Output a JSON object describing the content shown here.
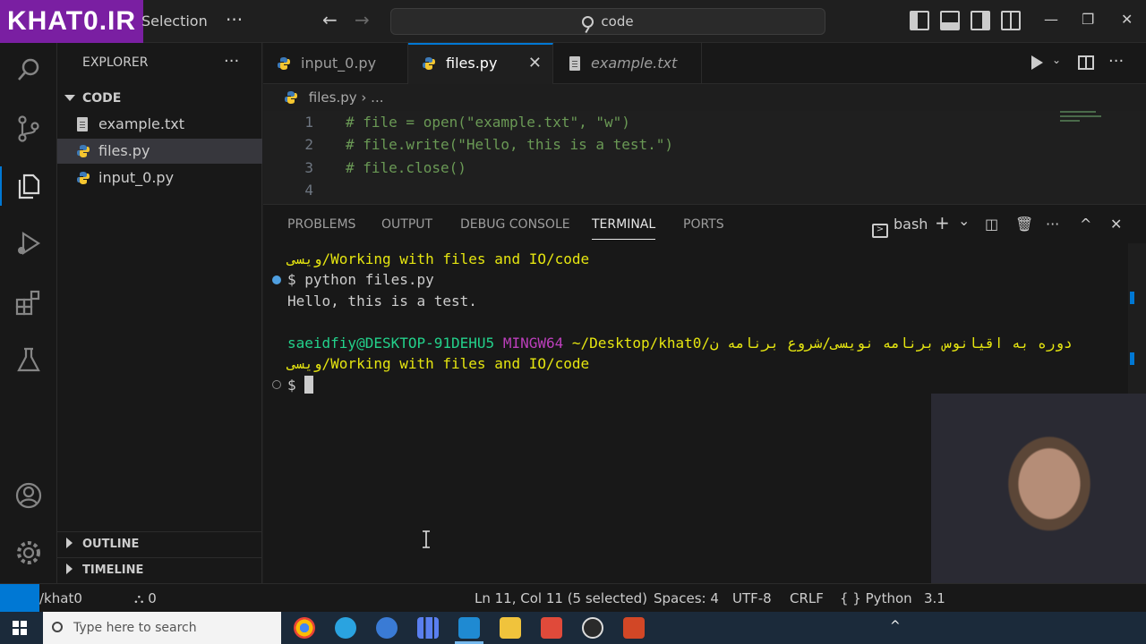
{
  "titlebar": {
    "logo_text": "KHAT0.IR",
    "menu_selection": "Selection",
    "menu_more": "···",
    "back": "←",
    "forward": "→",
    "command_center": "code",
    "minimize": "—",
    "restore": "❐",
    "close": "✕"
  },
  "sidebar": {
    "title": "EXPLORER",
    "more": "···",
    "folder": "CODE",
    "files": [
      {
        "name": "example.txt",
        "icon": "text-file-icon"
      },
      {
        "name": "files.py",
        "icon": "python-icon"
      },
      {
        "name": "input_0.py",
        "icon": "python-icon"
      }
    ],
    "outline": "OUTLINE",
    "timeline": "TIMELINE"
  },
  "tabs": [
    {
      "label": "input_0.py"
    },
    {
      "label": "files.py",
      "close": "✕"
    },
    {
      "label": "example.txt"
    }
  ],
  "tabs_more": "···",
  "breadcrumb": {
    "file": "files.py",
    "sep": "›",
    "more": "..."
  },
  "editor": {
    "lines": [
      {
        "num": "1",
        "code": "# file = open(\"example.txt\", \"w\")"
      },
      {
        "num": "2",
        "code": "# file.write(\"Hello, this is a test.\")"
      },
      {
        "num": "3",
        "code": "# file.close()"
      },
      {
        "num": "4",
        "code": ""
      }
    ]
  },
  "panel": {
    "tabs": [
      "PROBLEMS",
      "OUTPUT",
      "DEBUG CONSOLE",
      "TERMINAL",
      "PORTS"
    ],
    "shell": "bash",
    "add": "+",
    "dropdown": "⌄",
    "more": "···",
    "maximize": "^",
    "close": "✕"
  },
  "terminal": {
    "line1": "ویسی/Working with files and IO/code",
    "line2": "$ python files.py",
    "line3": "Hello, this is a test.",
    "prompt_user": "saeidfiy@DESKTOP-91DEHU5",
    "prompt_env": "MINGW64",
    "prompt_path": "~/Desktop/khat0/دوره به اقیانوس برنامه نویسی/شروع برنامه ن",
    "line5": "ویسی/Working with files and IO/code",
    "line6": "$ "
  },
  "statusbar": {
    "left_text": "/khat0",
    "errors": "0",
    "ports": "0",
    "position": "Ln 11, Col 11 (5 selected)",
    "spaces": "Spaces: 4",
    "encoding": "UTF-8",
    "eol": "CRLF",
    "language_icon": "{ }",
    "language": "Python",
    "version": "3.1"
  },
  "taskbar": {
    "search_placeholder": "Type here to search",
    "tray_up": "^"
  },
  "colors": {
    "accent": "#0078d4",
    "comment": "#6a9955",
    "term_green": "#23d18b",
    "term_purple": "#bc3fbc",
    "term_yellow": "#e5e510",
    "logo_bg": "#7a1fa2"
  }
}
